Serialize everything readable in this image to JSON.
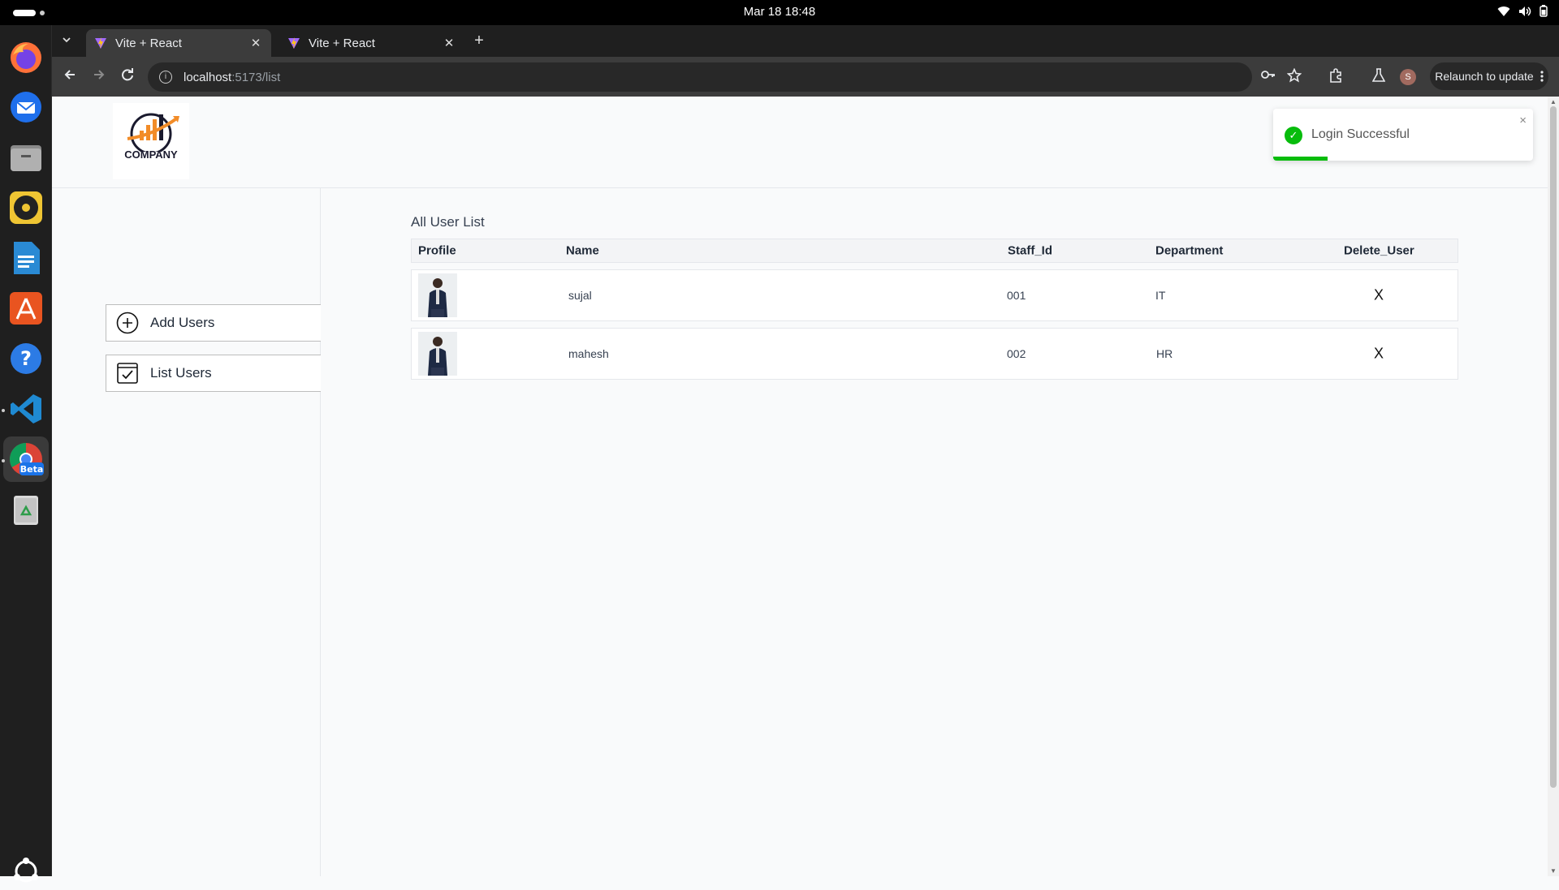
{
  "system": {
    "clock": "Mar 18  18:48"
  },
  "dock": {
    "apps": [
      "firefox-icon",
      "thunderbird-icon",
      "files-icon",
      "rhythmbox-icon",
      "writer-icon",
      "app-center-icon",
      "help-icon",
      "vscode-icon",
      "chrome-beta-icon",
      "trash-icon"
    ],
    "chrome_badge": "Beta"
  },
  "browser": {
    "tabs": [
      {
        "title": "Vite + React",
        "active": true
      },
      {
        "title": "Vite + React",
        "active": false
      }
    ],
    "url_host": "localhost",
    "url_path": ":5173/list",
    "profile_initial": "S",
    "relaunch_label": "Relaunch to update"
  },
  "header": {
    "logo_text": "COMPANY"
  },
  "sidebar": {
    "items": [
      {
        "label": "Add Users"
      },
      {
        "label": "List Users"
      }
    ]
  },
  "main": {
    "title": "All User List",
    "columns": [
      "Profile",
      "Name",
      "Staff_Id",
      "Department",
      "Delete_User"
    ],
    "rows": [
      {
        "name": "sujal",
        "staff_id": "001",
        "department": "IT",
        "delete": "X"
      },
      {
        "name": "mahesh",
        "staff_id": "002",
        "department": "HR",
        "delete": "X"
      }
    ]
  },
  "toast": {
    "message": "Login Successful",
    "close": "×",
    "progress": 0.21,
    "color": "#07bc0c"
  }
}
